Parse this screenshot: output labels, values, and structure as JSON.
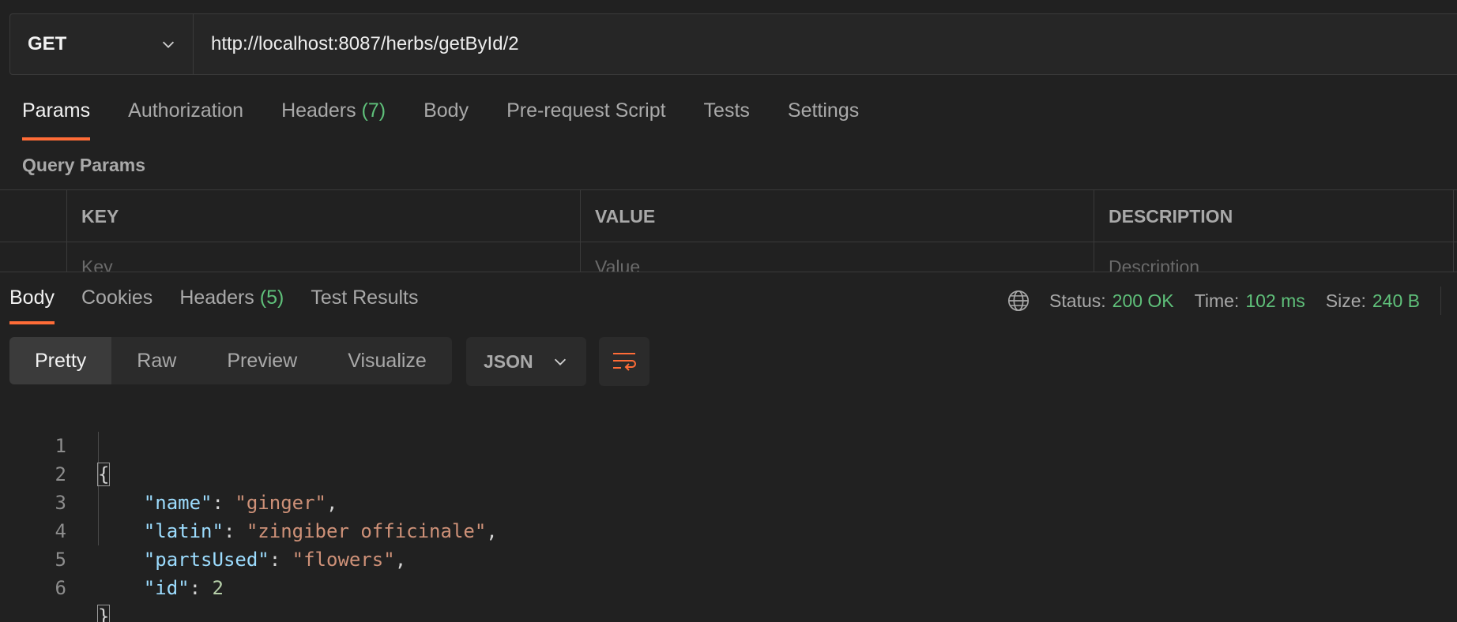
{
  "request": {
    "method": "GET",
    "url": "http://localhost:8087/herbs/getById/2"
  },
  "request_tabs": [
    {
      "label": "Params"
    },
    {
      "label": "Authorization"
    },
    {
      "label": "Headers",
      "count": "(7)"
    },
    {
      "label": "Body"
    },
    {
      "label": "Pre-request Script"
    },
    {
      "label": "Tests"
    },
    {
      "label": "Settings"
    }
  ],
  "query_params": {
    "title": "Query Params",
    "columns": [
      "KEY",
      "VALUE",
      "DESCRIPTION"
    ],
    "placeholders": [
      "Key",
      "Value",
      "Description"
    ]
  },
  "response_tabs": [
    {
      "label": "Body"
    },
    {
      "label": "Cookies"
    },
    {
      "label": "Headers",
      "count": "(5)"
    },
    {
      "label": "Test Results"
    }
  ],
  "response_meta": {
    "status_label": "Status:",
    "status_value": "200 OK",
    "time_label": "Time:",
    "time_value": "102 ms",
    "size_label": "Size:",
    "size_value": "240 B"
  },
  "view_modes": [
    "Pretty",
    "Raw",
    "Preview",
    "Visualize"
  ],
  "format": "JSON",
  "icons": {
    "method_dropdown": "chevron-down-icon",
    "globe": "globe-icon",
    "format_dropdown": "chevron-down-icon",
    "wrap": "wrap-lines-icon"
  },
  "colors": {
    "accent": "#ff6c37",
    "success": "#5fc07a",
    "json_key": "#9cdcfe",
    "json_string": "#ce9178",
    "json_number": "#b5cea8"
  },
  "code": {
    "line_numbers": [
      "1",
      "2",
      "3",
      "4",
      "5",
      "6"
    ],
    "open_brace": "{",
    "close_brace": "}",
    "fields": [
      {
        "key": "\"name\"",
        "sep": ": ",
        "value": "\"ginger\"",
        "trail": ","
      },
      {
        "key": "\"latin\"",
        "sep": ": ",
        "value": "\"zingiber officinale\"",
        "trail": ","
      },
      {
        "key": "\"partsUsed\"",
        "sep": ": ",
        "value": "\"flowers\"",
        "trail": ","
      },
      {
        "key": "\"id\"",
        "sep": ": ",
        "value": "2",
        "trail": ""
      }
    ]
  }
}
